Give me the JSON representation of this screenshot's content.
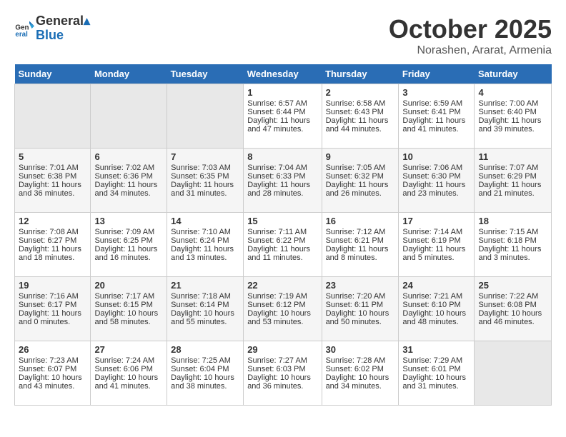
{
  "header": {
    "logo_line1": "General",
    "logo_line2": "Blue",
    "month": "October 2025",
    "location": "Norashen, Ararat, Armenia"
  },
  "days_of_week": [
    "Sunday",
    "Monday",
    "Tuesday",
    "Wednesday",
    "Thursday",
    "Friday",
    "Saturday"
  ],
  "weeks": [
    [
      {
        "day": "",
        "empty": true
      },
      {
        "day": "",
        "empty": true
      },
      {
        "day": "",
        "empty": true
      },
      {
        "day": "1",
        "rise": "6:57 AM",
        "set": "6:44 PM",
        "daylight": "11 hours and 47 minutes."
      },
      {
        "day": "2",
        "rise": "6:58 AM",
        "set": "6:43 PM",
        "daylight": "11 hours and 44 minutes."
      },
      {
        "day": "3",
        "rise": "6:59 AM",
        "set": "6:41 PM",
        "daylight": "11 hours and 41 minutes."
      },
      {
        "day": "4",
        "rise": "7:00 AM",
        "set": "6:40 PM",
        "daylight": "11 hours and 39 minutes."
      }
    ],
    [
      {
        "day": "5",
        "rise": "7:01 AM",
        "set": "6:38 PM",
        "daylight": "11 hours and 36 minutes."
      },
      {
        "day": "6",
        "rise": "7:02 AM",
        "set": "6:36 PM",
        "daylight": "11 hours and 34 minutes."
      },
      {
        "day": "7",
        "rise": "7:03 AM",
        "set": "6:35 PM",
        "daylight": "11 hours and 31 minutes."
      },
      {
        "day": "8",
        "rise": "7:04 AM",
        "set": "6:33 PM",
        "daylight": "11 hours and 28 minutes."
      },
      {
        "day": "9",
        "rise": "7:05 AM",
        "set": "6:32 PM",
        "daylight": "11 hours and 26 minutes."
      },
      {
        "day": "10",
        "rise": "7:06 AM",
        "set": "6:30 PM",
        "daylight": "11 hours and 23 minutes."
      },
      {
        "day": "11",
        "rise": "7:07 AM",
        "set": "6:29 PM",
        "daylight": "11 hours and 21 minutes."
      }
    ],
    [
      {
        "day": "12",
        "rise": "7:08 AM",
        "set": "6:27 PM",
        "daylight": "11 hours and 18 minutes."
      },
      {
        "day": "13",
        "rise": "7:09 AM",
        "set": "6:25 PM",
        "daylight": "11 hours and 16 minutes."
      },
      {
        "day": "14",
        "rise": "7:10 AM",
        "set": "6:24 PM",
        "daylight": "11 hours and 13 minutes."
      },
      {
        "day": "15",
        "rise": "7:11 AM",
        "set": "6:22 PM",
        "daylight": "11 hours and 11 minutes."
      },
      {
        "day": "16",
        "rise": "7:12 AM",
        "set": "6:21 PM",
        "daylight": "11 hours and 8 minutes."
      },
      {
        "day": "17",
        "rise": "7:14 AM",
        "set": "6:19 PM",
        "daylight": "11 hours and 5 minutes."
      },
      {
        "day": "18",
        "rise": "7:15 AM",
        "set": "6:18 PM",
        "daylight": "11 hours and 3 minutes."
      }
    ],
    [
      {
        "day": "19",
        "rise": "7:16 AM",
        "set": "6:17 PM",
        "daylight": "11 hours and 0 minutes."
      },
      {
        "day": "20",
        "rise": "7:17 AM",
        "set": "6:15 PM",
        "daylight": "10 hours and 58 minutes."
      },
      {
        "day": "21",
        "rise": "7:18 AM",
        "set": "6:14 PM",
        "daylight": "10 hours and 55 minutes."
      },
      {
        "day": "22",
        "rise": "7:19 AM",
        "set": "6:12 PM",
        "daylight": "10 hours and 53 minutes."
      },
      {
        "day": "23",
        "rise": "7:20 AM",
        "set": "6:11 PM",
        "daylight": "10 hours and 50 minutes."
      },
      {
        "day": "24",
        "rise": "7:21 AM",
        "set": "6:10 PM",
        "daylight": "10 hours and 48 minutes."
      },
      {
        "day": "25",
        "rise": "7:22 AM",
        "set": "6:08 PM",
        "daylight": "10 hours and 46 minutes."
      }
    ],
    [
      {
        "day": "26",
        "rise": "7:23 AM",
        "set": "6:07 PM",
        "daylight": "10 hours and 43 minutes."
      },
      {
        "day": "27",
        "rise": "7:24 AM",
        "set": "6:06 PM",
        "daylight": "10 hours and 41 minutes."
      },
      {
        "day": "28",
        "rise": "7:25 AM",
        "set": "6:04 PM",
        "daylight": "10 hours and 38 minutes."
      },
      {
        "day": "29",
        "rise": "7:27 AM",
        "set": "6:03 PM",
        "daylight": "10 hours and 36 minutes."
      },
      {
        "day": "30",
        "rise": "7:28 AM",
        "set": "6:02 PM",
        "daylight": "10 hours and 34 minutes."
      },
      {
        "day": "31",
        "rise": "7:29 AM",
        "set": "6:01 PM",
        "daylight": "10 hours and 31 minutes."
      },
      {
        "day": "",
        "empty": true
      }
    ]
  ]
}
